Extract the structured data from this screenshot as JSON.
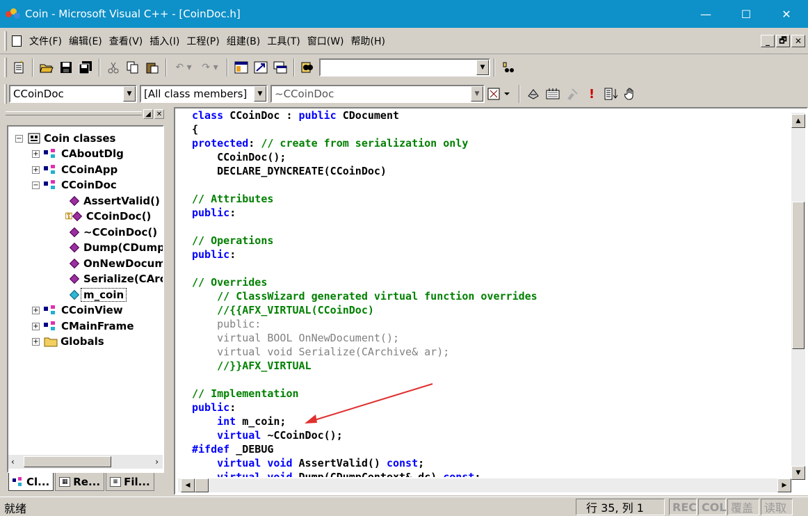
{
  "window": {
    "title": "Coin - Microsoft Visual C++ - [CoinDoc.h]",
    "minimize": "—",
    "maximize": "☐",
    "close": "✕"
  },
  "menu": {
    "items": [
      "文件(F)",
      "编辑(E)",
      "查看(V)",
      "插入(I)",
      "工程(P)",
      "组建(B)",
      "工具(T)",
      "窗口(W)",
      "帮助(H)"
    ],
    "mdi_min": "_",
    "mdi_restore": "🗗",
    "mdi_close": "✕"
  },
  "toolbar": {
    "find_combo_value": ""
  },
  "wizardbar": {
    "class_combo": "CCoinDoc",
    "filter_combo": "[All class members]",
    "member_combo": "~CCoinDoc"
  },
  "workspace": {
    "tree": {
      "root": "Coin classes",
      "classes": [
        "CAboutDlg",
        "CCoinApp",
        "CCoinDoc",
        "CCoinView",
        "CMainFrame"
      ],
      "members": [
        "AssertValid()",
        "CCoinDoc()",
        "~CCoinDoc()",
        "Dump(CDump",
        "OnNewDocum",
        "Serialize(CArc",
        "m_coin"
      ],
      "globals": "Globals"
    },
    "tabs": [
      "Cl...",
      "Re...",
      "Fil..."
    ]
  },
  "editor": {
    "lines": [
      [
        [
          "kw",
          "class "
        ],
        [
          "tx",
          "CCoinDoc : "
        ],
        [
          "kw",
          "public "
        ],
        [
          "tx",
          "CDocument"
        ]
      ],
      [
        [
          "tx",
          "{"
        ]
      ],
      [
        [
          "kw",
          "protected"
        ],
        [
          "tx",
          ": "
        ],
        [
          "cm",
          "// create from serialization only"
        ]
      ],
      [
        [
          "tx",
          "    CCoinDoc();"
        ]
      ],
      [
        [
          "tx",
          "    DECLARE_DYNCREATE(CCoinDoc)"
        ]
      ],
      [
        [
          "tx",
          ""
        ]
      ],
      [
        [
          "cm",
          "// Attributes"
        ]
      ],
      [
        [
          "kw",
          "public"
        ],
        [
          "tx",
          ":"
        ]
      ],
      [
        [
          "tx",
          ""
        ]
      ],
      [
        [
          "cm",
          "// Operations"
        ]
      ],
      [
        [
          "kw",
          "public"
        ],
        [
          "tx",
          ":"
        ]
      ],
      [
        [
          "tx",
          ""
        ]
      ],
      [
        [
          "cm",
          "// Overrides"
        ]
      ],
      [
        [
          "cm",
          "    // ClassWizard generated virtual function overrides"
        ]
      ],
      [
        [
          "cm",
          "    //{{AFX_VIRTUAL(CCoinDoc)"
        ]
      ],
      [
        [
          "gr",
          "    public:"
        ]
      ],
      [
        [
          "gr",
          "    virtual BOOL OnNewDocument();"
        ]
      ],
      [
        [
          "gr",
          "    virtual void Serialize(CArchive& ar);"
        ]
      ],
      [
        [
          "cm",
          "    //}}AFX_VIRTUAL"
        ]
      ],
      [
        [
          "tx",
          ""
        ]
      ],
      [
        [
          "cm",
          "// Implementation"
        ]
      ],
      [
        [
          "kw",
          "public"
        ],
        [
          "tx",
          ":"
        ]
      ],
      [
        [
          "kw",
          "    int "
        ],
        [
          "tx",
          "m_coin;"
        ]
      ],
      [
        [
          "kw",
          "    virtual "
        ],
        [
          "tx",
          "~CCoinDoc();"
        ]
      ],
      [
        [
          "kw",
          "#ifdef "
        ],
        [
          "tx",
          "_DEBUG"
        ]
      ],
      [
        [
          "kw",
          "    virtual void "
        ],
        [
          "tx",
          "AssertValid() "
        ],
        [
          "kw",
          "const"
        ],
        [
          "tx",
          ";"
        ]
      ],
      [
        [
          "kw",
          "    virtual void "
        ],
        [
          "tx",
          "Dump(CDumpContext& dc) "
        ],
        [
          "kw",
          "const"
        ],
        [
          "tx",
          ";"
        ]
      ]
    ]
  },
  "status": {
    "message": "就绪",
    "position": "行 35, 列 1",
    "rec": "REC",
    "col": "COL",
    "ovr": "覆盖",
    "read": "读取"
  },
  "colors": {
    "titlebar": "#0e90c8",
    "keyword": "#0000ff",
    "comment": "#008000",
    "inactive_code": "#808080",
    "annotation_arrow": "#e03030"
  }
}
